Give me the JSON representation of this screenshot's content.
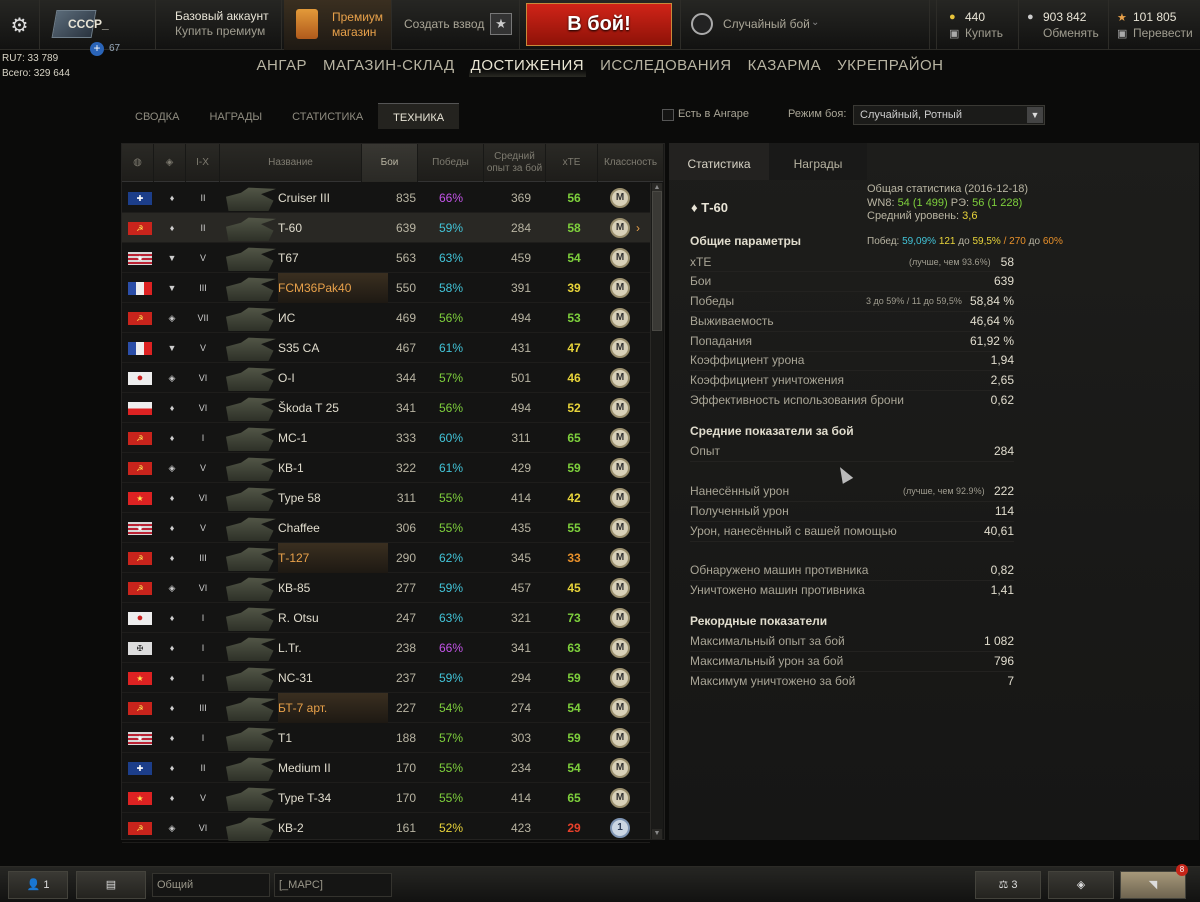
{
  "header": {
    "nation": "СССР_",
    "plus_count": "67",
    "account_type": "Базовый аккаунт",
    "buy_premium": "Купить премиум",
    "premium_shop_l1": "Премиум",
    "premium_shop_l2": "магазин",
    "create_platoon": "Создать взвод",
    "battle_button": "В бой!",
    "battle_mode": "Случайный бой",
    "gold": "440",
    "gold_action": "Купить",
    "credits": "903 842",
    "credits_action": "Обменять",
    "free_xp": "101 805",
    "free_xp_action": "Перевести",
    "ru7": "RU7: 33 789",
    "total": "Всего: 329 644"
  },
  "nav": {
    "items": [
      "АНГАР",
      "МАГАЗИН-СКЛАД",
      "ДОСТИЖЕНИЯ",
      "ИССЛЕДОВАНИЯ",
      "КАЗАРМА",
      "УКРЕПРАЙОН"
    ],
    "active": "ДОСТИЖЕНИЯ"
  },
  "subtabs": [
    "СВОДКА",
    "НАГРАДЫ",
    "СТАТИСТИКА",
    "ТЕХНИКА"
  ],
  "filter": {
    "in_hangar": "Есть в Ангаре",
    "mode_label": "Режим боя:",
    "mode_value": "Случайный, Ротный"
  },
  "table": {
    "headers": {
      "tier": "I-X",
      "name": "Название",
      "battles": "Бои",
      "wins": "Победы",
      "avg_exp": "Средний опыт за бой",
      "xte": "xTE",
      "class": "Классность"
    },
    "rows": [
      {
        "flag": "uk",
        "cls": "♦",
        "tier": "II",
        "name": "Cruiser III",
        "battles": "835",
        "wr": "66%",
        "wrc": "purple",
        "exp": "369",
        "xte": "56",
        "xtec": "green",
        "medal": "M"
      },
      {
        "flag": "ussr",
        "cls": "♦",
        "tier": "II",
        "name": "T-60",
        "battles": "639",
        "wr": "59%",
        "wrc": "cyan",
        "exp": "284",
        "xte": "58",
        "xtec": "green",
        "medal": "M",
        "selected": true
      },
      {
        "flag": "usa",
        "cls": "▼",
        "tier": "V",
        "name": "T67",
        "battles": "563",
        "wr": "63%",
        "wrc": "cyan",
        "exp": "459",
        "xte": "54",
        "xtec": "green",
        "medal": "M"
      },
      {
        "flag": "fr",
        "cls": "▼",
        "tier": "III",
        "name": "FCM36Pak40",
        "battles": "550",
        "wr": "58%",
        "wrc": "cyan",
        "exp": "391",
        "xte": "39",
        "xtec": "yellow",
        "medal": "M",
        "premium": true
      },
      {
        "flag": "ussr",
        "cls": "◈",
        "tier": "VII",
        "name": "ИС",
        "battles": "469",
        "wr": "56%",
        "wrc": "green",
        "exp": "494",
        "xte": "53",
        "xtec": "green",
        "medal": "M"
      },
      {
        "flag": "fr",
        "cls": "▼",
        "tier": "V",
        "name": "S35 CA",
        "battles": "467",
        "wr": "61%",
        "wrc": "cyan",
        "exp": "431",
        "xte": "47",
        "xtec": "yellow",
        "medal": "M"
      },
      {
        "flag": "jp",
        "cls": "◈",
        "tier": "VI",
        "name": "O-I",
        "battles": "344",
        "wr": "57%",
        "wrc": "green",
        "exp": "501",
        "xte": "46",
        "xtec": "yellow",
        "medal": "M"
      },
      {
        "flag": "cz",
        "cls": "♦",
        "tier": "VI",
        "name": "Škoda T 25",
        "battles": "341",
        "wr": "56%",
        "wrc": "green",
        "exp": "494",
        "xte": "52",
        "xtec": "yellow",
        "medal": "M"
      },
      {
        "flag": "ussr",
        "cls": "♦",
        "tier": "I",
        "name": "МС-1",
        "battles": "333",
        "wr": "60%",
        "wrc": "cyan",
        "exp": "311",
        "xte": "65",
        "xtec": "green",
        "medal": "M"
      },
      {
        "flag": "ussr",
        "cls": "◈",
        "tier": "V",
        "name": "КВ-1",
        "battles": "322",
        "wr": "61%",
        "wrc": "cyan",
        "exp": "429",
        "xte": "59",
        "xtec": "green",
        "medal": "M"
      },
      {
        "flag": "cn",
        "cls": "♦",
        "tier": "VI",
        "name": "Type 58",
        "battles": "311",
        "wr": "55%",
        "wrc": "green",
        "exp": "414",
        "xte": "42",
        "xtec": "yellow",
        "medal": "M"
      },
      {
        "flag": "usa",
        "cls": "♦",
        "tier": "V",
        "name": "Chaffee",
        "battles": "306",
        "wr": "55%",
        "wrc": "green",
        "exp": "435",
        "xte": "55",
        "xtec": "green",
        "medal": "M"
      },
      {
        "flag": "ussr",
        "cls": "♦",
        "tier": "III",
        "name": "Т-127",
        "battles": "290",
        "wr": "62%",
        "wrc": "cyan",
        "exp": "345",
        "xte": "33",
        "xtec": "orange",
        "medal": "M",
        "premium": true
      },
      {
        "flag": "ussr",
        "cls": "◈",
        "tier": "VI",
        "name": "КВ-85",
        "battles": "277",
        "wr": "59%",
        "wrc": "cyan",
        "exp": "457",
        "xte": "45",
        "xtec": "yellow",
        "medal": "M"
      },
      {
        "flag": "jp",
        "cls": "♦",
        "tier": "I",
        "name": "R. Otsu",
        "battles": "247",
        "wr": "63%",
        "wrc": "cyan",
        "exp": "321",
        "xte": "73",
        "xtec": "green",
        "medal": "M"
      },
      {
        "flag": "de",
        "cls": "♦",
        "tier": "I",
        "name": "L.Tr.",
        "battles": "238",
        "wr": "66%",
        "wrc": "purple",
        "exp": "341",
        "xte": "63",
        "xtec": "green",
        "medal": "M"
      },
      {
        "flag": "cn",
        "cls": "♦",
        "tier": "I",
        "name": "NC-31",
        "battles": "237",
        "wr": "59%",
        "wrc": "cyan",
        "exp": "294",
        "xte": "59",
        "xtec": "green",
        "medal": "M"
      },
      {
        "flag": "ussr",
        "cls": "♦",
        "tier": "III",
        "name": "БТ-7 арт.",
        "battles": "227",
        "wr": "54%",
        "wrc": "green",
        "exp": "274",
        "xte": "54",
        "xtec": "green",
        "medal": "M",
        "premium": true
      },
      {
        "flag": "usa",
        "cls": "♦",
        "tier": "I",
        "name": "T1",
        "battles": "188",
        "wr": "57%",
        "wrc": "green",
        "exp": "303",
        "xte": "59",
        "xtec": "green",
        "medal": "M"
      },
      {
        "flag": "uk",
        "cls": "♦",
        "tier": "II",
        "name": "Medium II",
        "battles": "170",
        "wr": "55%",
        "wrc": "green",
        "exp": "234",
        "xte": "54",
        "xtec": "green",
        "medal": "M"
      },
      {
        "flag": "cn",
        "cls": "♦",
        "tier": "V",
        "name": "Type T-34",
        "battles": "170",
        "wr": "55%",
        "wrc": "green",
        "exp": "414",
        "xte": "65",
        "xtec": "green",
        "medal": "M"
      },
      {
        "flag": "ussr",
        "cls": "◈",
        "tier": "VI",
        "name": "КВ-2",
        "battles": "161",
        "wr": "52%",
        "wrc": "yellow",
        "exp": "423",
        "xte": "29",
        "xtec": "red",
        "medal": "1"
      }
    ]
  },
  "details": {
    "tabs": [
      "Статистика",
      "Награды"
    ],
    "tank": "Т-60",
    "general_title": "Общая статистика (2016-12-18)",
    "wn8_label": "WN8:",
    "wn8_value": "54 (1 499)",
    "re_label": "РЭ:",
    "re_value": "56 (1 228)",
    "avg_tier_label": "Средний уровень:",
    "avg_tier_value": "3,6",
    "section_general": "Общие параметры",
    "wins_summary_label": "Побед:",
    "wins_summary_pct": "59,09%",
    "wins_summary_a": "121",
    "wins_summary_a_to": "до",
    "wins_summary_a_pct": "59,5%",
    "wins_summary_b": "/ 270",
    "wins_summary_b_to": "до",
    "wins_summary_b_pct": "60%",
    "xte_label": "xTE",
    "xte_note": "(лучше, чем 93.6%)",
    "xte_value": "58",
    "battles_label": "Бои",
    "battles_value": "639",
    "wins_label": "Победы",
    "wins_note": "3 до 59% / 11 до 59,5%",
    "wins_value": "58,84 %",
    "survival_label": "Выживаемость",
    "survival_value": "46,64 %",
    "hits_label": "Попадания",
    "hits_value": "61,92 %",
    "dmg_ratio_label": "Коэффициент урона",
    "dmg_ratio_value": "1,94",
    "kill_ratio_label": "Коэффициент уничтожения",
    "kill_ratio_value": "2,65",
    "armor_label": "Эффективность использования брони",
    "armor_value": "0,62",
    "section_avg": "Средние показатели за бой",
    "exp_label": "Опыт",
    "exp_value": "284",
    "dmg_label": "Нанесённый урон",
    "dmg_note": "(лучше, чем 92.9%)",
    "dmg_value": "222",
    "recv_label": "Полученный урон",
    "recv_value": "114",
    "assist_label": "Урон, нанесённый с вашей помощью",
    "assist_value": "40,61",
    "spot_label": "Обнаружено машин противника",
    "spot_value": "0,82",
    "frag_label": "Уничтожено машин противника",
    "frag_value": "1,41",
    "section_records": "Рекордные показатели",
    "max_exp_label": "Максимальный опыт за бой",
    "max_exp_value": "1 082",
    "max_dmg_label": "Максимальный урон за бой",
    "max_dmg_value": "796",
    "max_kills_label": "Максимум уничтожено за бой",
    "max_kills_value": "7"
  },
  "bottom": {
    "friends_count": "1",
    "channel_general": "Общий",
    "channel_clan": "[_МАРС]",
    "compare_count": "3",
    "notifications": "8"
  },
  "colors": {
    "purple": "#c354e8",
    "cyan": "#42c4d8",
    "green": "#7ed03c",
    "yellow": "#e8d43a",
    "orange": "#e8902a",
    "red": "#e8402a",
    "accent": "#e8a14a"
  }
}
